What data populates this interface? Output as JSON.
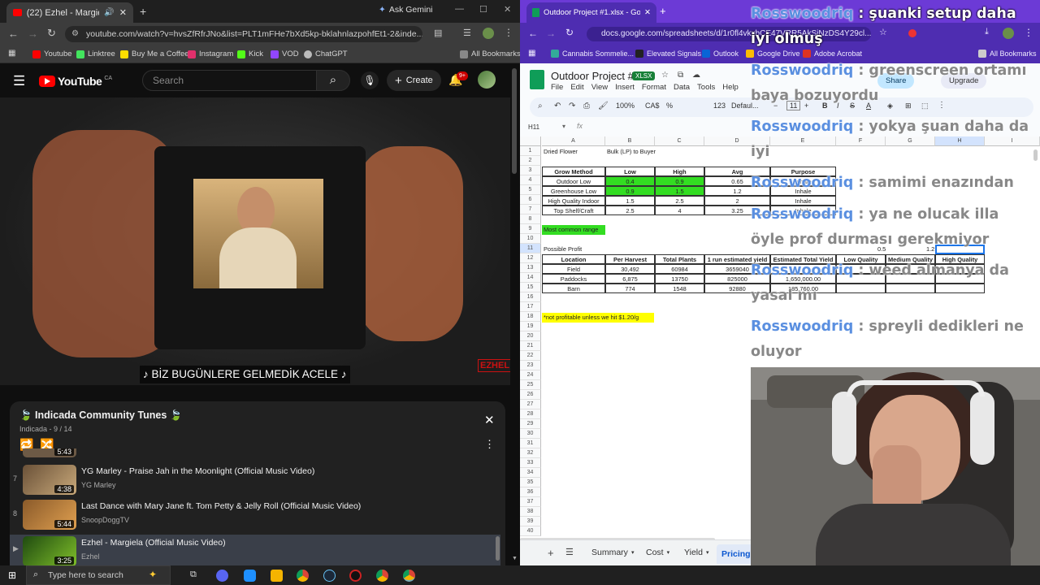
{
  "left_browser": {
    "tab_title": "(22) Ezhel - Margiela (Offici",
    "new_tab": "+",
    "ask_gemini": "Ask Gemini",
    "url": "youtube.com/watch?v=hvsZfRfrJNo&list=PLT1mFHe7bXd5kp-bklahnlazpohfEt1-2&inde...",
    "bookmarks": [
      "Youtube",
      "Linktree",
      "Buy Me a Coffee",
      "Instagram",
      "Kick",
      "VOD",
      "ChatGPT"
    ],
    "all_bookmarks": "All Bookmarks"
  },
  "youtube": {
    "logo": "YouTube",
    "country": "CA",
    "search_placeholder": "Search",
    "create": "Create",
    "notif_count": "9+",
    "subtitle": "♪ BİZ BUGÜNLERE GELMEDİK ACELE ♪",
    "watermark": "EZHEL"
  },
  "playlist": {
    "title": "🍃 Indicada Community Tunes 🍃",
    "subtitle": "Indicada - 9 / 14",
    "items": [
      {
        "index": "7",
        "title": "YG Marley - Praise Jah in the Moonlight (Official Music Video)",
        "channel": "YG Marley",
        "duration": "4:38"
      },
      {
        "index": "8",
        "title": "Last Dance with Mary Jane ft. Tom Petty & Jelly Roll (Official Music Video)",
        "channel": "SnoopDoggTV",
        "duration": "5:44"
      },
      {
        "index": "▶",
        "title": "Ezhel - Margiela (Official Music Video)",
        "channel": "Ezhel",
        "duration": "3:25"
      }
    ],
    "partial_duration": "5:43"
  },
  "right_browser": {
    "tab_title": "Outdoor Project #1.xlsx - Goog",
    "url": "docs.google.com/spreadsheets/d/1r0fl4vkxbCE47VRR5AkSjNzDS4Y29cl...",
    "bookmarks": [
      "Cannabis Sommelie...",
      "Elevated Signals",
      "Outlook",
      "Google Drive",
      "Adobe Acrobat"
    ],
    "all_bookmarks": "All Bookmarks"
  },
  "sheets": {
    "doc_title": "Outdoor Project #1",
    "badge": "XLSX",
    "menu": [
      "File",
      "Edit",
      "View",
      "Insert",
      "Format",
      "Data",
      "Tools",
      "Help"
    ],
    "share": "Share",
    "upgrade": "Upgrade",
    "zoom": "100%",
    "currency": "CA$",
    "percent": "%",
    "number_fmt": "123",
    "font": "Defaul...",
    "font_size": "11",
    "name_box": "H11",
    "columns": [
      "A",
      "B",
      "C",
      "D",
      "E",
      "F",
      "G",
      "H",
      "I"
    ],
    "rows": [
      "1",
      "2",
      "3",
      "4",
      "5",
      "6",
      "7",
      "8",
      "9",
      "10",
      "11",
      "12",
      "13",
      "14",
      "15",
      "16",
      "17",
      "18",
      "19",
      "20",
      "21",
      "22",
      "23",
      "24",
      "25",
      "26",
      "27",
      "28",
      "29",
      "30",
      "31",
      "32",
      "33",
      "34",
      "35",
      "36",
      "37",
      "38",
      "39",
      "40"
    ],
    "a1": "Dried Flower",
    "b1": "Bulk (LP) to Buyer",
    "grow_header": [
      "Grow Method",
      "Low",
      "High",
      "Avg",
      "Purpose"
    ],
    "grow_rows": [
      [
        "Outdoor Low",
        "0.4",
        "0.9",
        "0.65",
        "Inhale"
      ],
      [
        "Greenhouse Low",
        "0.9",
        "1.5",
        "1.2",
        "Inhale"
      ],
      [
        "High Quality Indoor",
        "1.5",
        "2.5",
        "2",
        "Inhale"
      ],
      [
        "Top Shelf/Craft",
        "2.5",
        "4",
        "3.25",
        "Inhale"
      ]
    ],
    "common_range": "Most common range",
    "possible_profit": "Possible Profit",
    "f11": "0.5",
    "g11": "1.2",
    "profit_header": [
      "Location",
      "Per Harvest",
      "Total Plants",
      "1 run estimated yield",
      "Estimated Total Yield",
      "Low Quality",
      "Medium Quality",
      "High Quality"
    ],
    "profit_rows": [
      [
        "Field",
        "30,492",
        "60984",
        "3659040",
        "",
        "",
        "",
        ""
      ],
      [
        "Paddocks",
        "6,875",
        "13750",
        "825000",
        "1,650,000.00",
        "",
        "",
        ""
      ],
      [
        "Barn",
        "774",
        "1548",
        "92880",
        "185,760.00",
        "",
        "",
        ""
      ]
    ],
    "note": "*not profitable unless we hit $1.20/g",
    "sheet_tabs": [
      "Summary",
      "Cost",
      "Yield",
      "Pricing"
    ],
    "active_tab": "Pricing"
  },
  "chat": [
    {
      "user": "Rosswoodriq",
      "text": ": şuanki setup daha iyi olmuş"
    },
    {
      "user": "Rosswoodriq",
      "text": ": greenscreen ortamı baya bozuyordu"
    },
    {
      "user": "Rosswoodriq",
      "text": ": yokya şuan daha da iyi"
    },
    {
      "user": "Rosswoodriq",
      "text": ": samimi enazından"
    },
    {
      "user": "Rosswoodriq",
      "text": ": ya ne olucak illa öyle prof durması gerekmiyor"
    },
    {
      "user": "Rosswoodriq",
      "text": ": weed almanya da yasal mı"
    },
    {
      "user": "Rosswoodriq",
      "text": ": spreyli dedikleri ne oluyor"
    }
  ],
  "taskbar": {
    "search_placeholder": "Type here to search"
  },
  "colors": {
    "green_fill": "#33dd22",
    "yellow_fill": "#ffff00",
    "youtube_red": "#ff0000",
    "chat_user": "#5a8fe0",
    "purple_theme": "#6c3ad6"
  }
}
